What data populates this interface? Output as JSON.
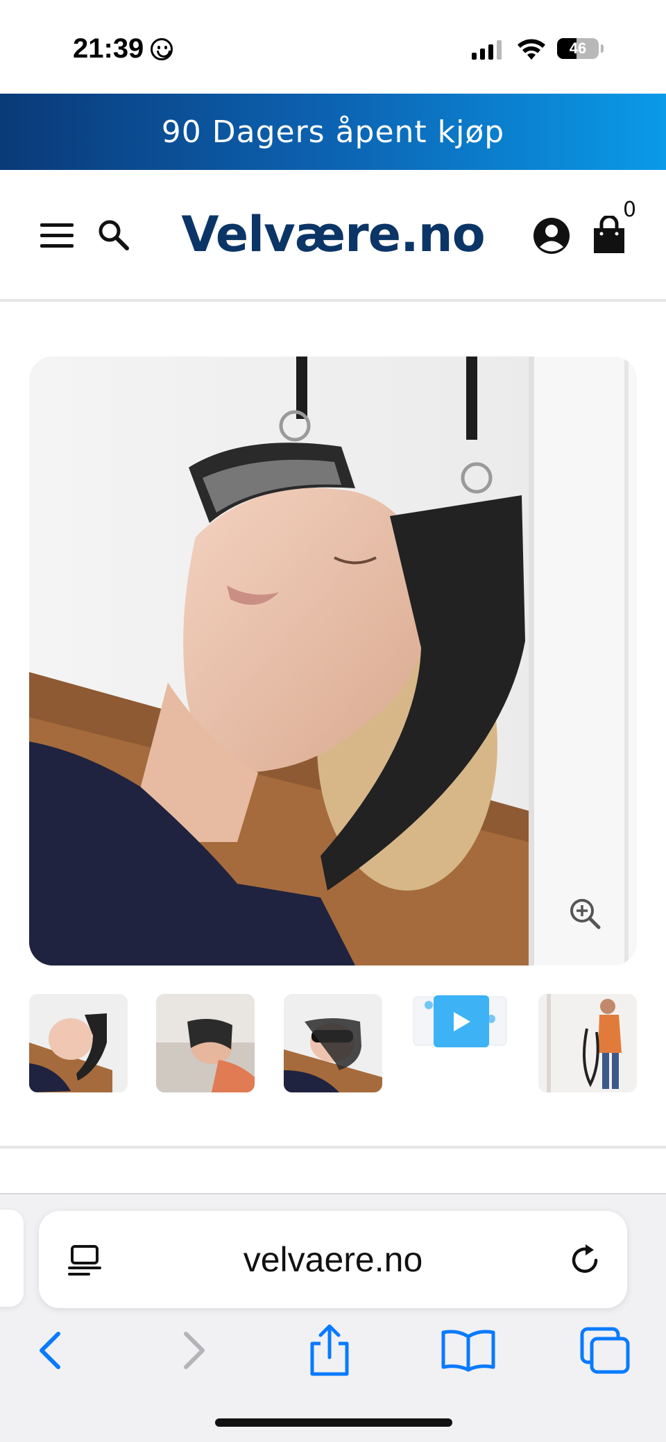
{
  "status_bar": {
    "time": "21:39",
    "battery": "46",
    "battery_level": 0.46
  },
  "promo_banner": {
    "text": "90 Dagers åpent kjøp"
  },
  "header": {
    "logo": "Velvære.no",
    "cart_count": "0",
    "icons": [
      "hamburger-menu-icon",
      "search-icon",
      "account-icon",
      "shopping-bag-icon"
    ]
  },
  "gallery": {
    "thumbnails": [
      {
        "label": "product-photo-1"
      },
      {
        "label": "product-photo-2"
      },
      {
        "label": "product-photo-3"
      },
      {
        "label": "product-video"
      },
      {
        "label": "product-photo-5"
      }
    ]
  },
  "browser": {
    "url": "velvaere.no",
    "nav_icons": [
      "back-icon",
      "forward-icon",
      "share-icon",
      "bookmarks-icon",
      "tabs-icon"
    ]
  },
  "colors": {
    "brand": "#0b3566",
    "banner_start": "#0a3a78",
    "banner_end": "#0a9ae8",
    "safari_blue": "#0a7aff"
  }
}
